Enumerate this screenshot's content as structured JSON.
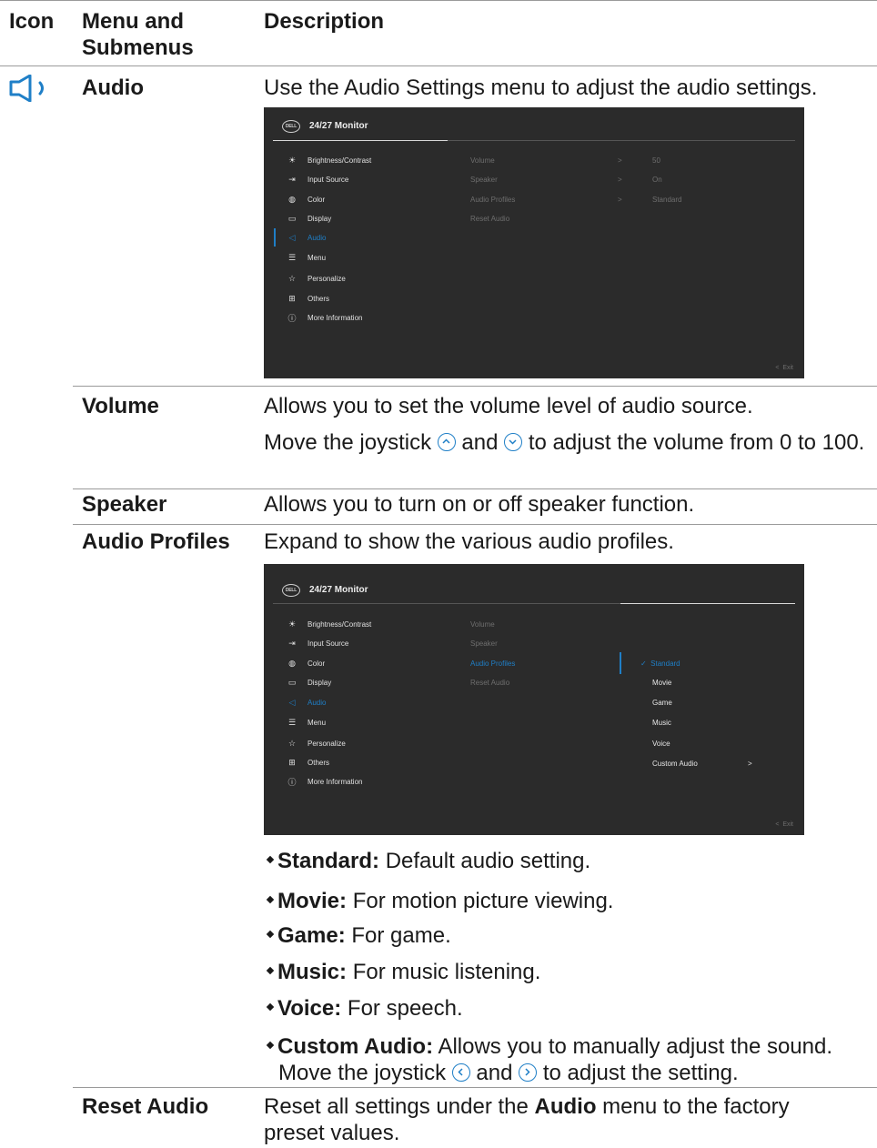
{
  "header": {
    "col_icon": "Icon",
    "col_menu": "Menu and",
    "col_menu2": "Submenus",
    "col_desc": "Description"
  },
  "audio": {
    "label": "Audio",
    "desc": "Use the Audio Settings menu to adjust the audio settings."
  },
  "osd": {
    "logo": "DELL",
    "title": "24/27 Monitor",
    "menu": [
      "Brightness/Contrast",
      "Input Source",
      "Color",
      "Display",
      "Audio",
      "Menu",
      "Personalize",
      "Others",
      "More Information"
    ],
    "sub": [
      "Volume",
      "Speaker",
      "Audio Profiles",
      "Reset Audio"
    ],
    "values": [
      "50",
      "On",
      "Standard"
    ],
    "profiles": [
      "Standard",
      "Movie",
      "Game",
      "Music",
      "Voice",
      "Custom Audio"
    ],
    "exit": "Exit",
    "chevron": ">",
    "exit_chevron": "<",
    "check": "✓"
  },
  "volume": {
    "label": "Volume",
    "desc1": "Allows you to set the volume level of audio source.",
    "desc2_a": "Move the joystick",
    "desc2_b": "and",
    "desc2_c": "to adjust the volume from 0 to 100."
  },
  "speaker": {
    "label": "Speaker",
    "desc": "Allows you to turn on or off speaker function."
  },
  "profiles": {
    "label": "Audio Profiles",
    "desc": "Expand to show the various audio profiles.",
    "bullets": [
      {
        "term": "Standard:",
        "text": "Default audio setting."
      },
      {
        "term": "Movie:",
        "text": "For motion picture viewing."
      },
      {
        "term": "Game:",
        "text": "For game."
      },
      {
        "term": "Music:",
        "text": "For music listening."
      },
      {
        "term": "Voice:",
        "text": "For speech."
      },
      {
        "term": "Custom Audio:",
        "text": "Allows you to manually adjust the sound."
      }
    ],
    "custom_a": "Move the joystick",
    "custom_b": "and",
    "custom_c": "to adjust the setting."
  },
  "reset": {
    "label": "Reset Audio",
    "desc_a": "Reset all settings under the",
    "desc_bold": "Audio",
    "desc_b": "menu to the factory preset values."
  },
  "colors": {
    "accent": "#1f7fc7",
    "osd_bg": "#2b2b2b"
  }
}
